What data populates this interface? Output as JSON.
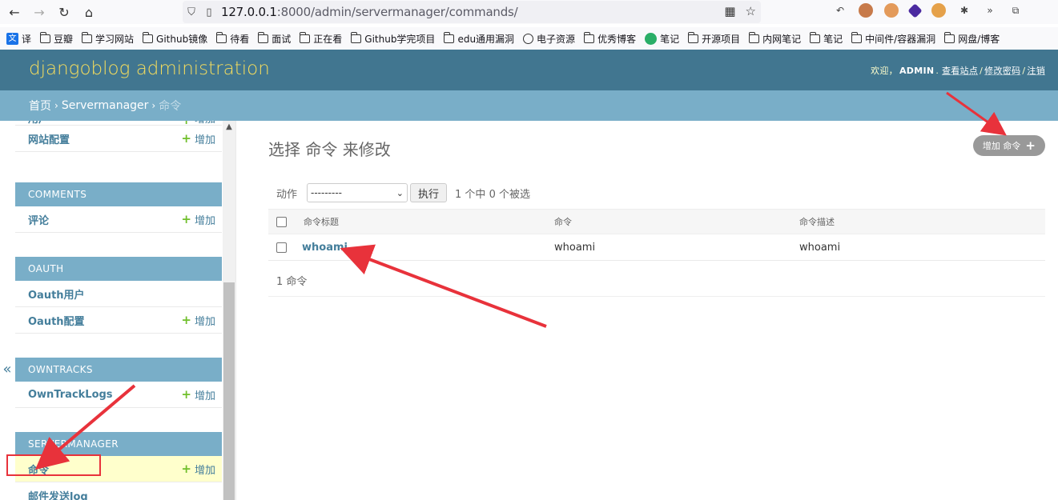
{
  "browser": {
    "url_host": "127.0.0.1",
    "url_rest": ":8000/admin/servermanager/commands/",
    "bookmarks": [
      {
        "label": "译",
        "icon": "translate-icon"
      },
      {
        "label": "豆瓣",
        "icon": "folder-icon"
      },
      {
        "label": "学习网站",
        "icon": "folder-icon"
      },
      {
        "label": "Github镜像",
        "icon": "folder-icon"
      },
      {
        "label": "待看",
        "icon": "folder-icon"
      },
      {
        "label": "面试",
        "icon": "folder-icon"
      },
      {
        "label": "正在看",
        "icon": "folder-icon"
      },
      {
        "label": "Github学完项目",
        "icon": "folder-icon"
      },
      {
        "label": "edu通用漏洞",
        "icon": "folder-icon"
      },
      {
        "label": "电子资源",
        "icon": "globe-icon"
      },
      {
        "label": "优秀博客",
        "icon": "folder-icon"
      },
      {
        "label": "笔记",
        "icon": "wechat-icon"
      },
      {
        "label": "开源项目",
        "icon": "folder-icon"
      },
      {
        "label": "内网笔记",
        "icon": "folder-icon"
      },
      {
        "label": "笔记",
        "icon": "folder-icon"
      },
      {
        "label": "中间件/容器漏洞",
        "icon": "folder-icon"
      },
      {
        "label": "网盘/博客",
        "icon": "folder-icon"
      }
    ]
  },
  "header": {
    "branding": "djangoblog administration",
    "welcome": "欢迎，",
    "username": "ADMIN",
    "view_site": "查看站点",
    "change_password": "修改密码",
    "logout": "注销",
    "separator": "/"
  },
  "breadcrumbs": {
    "home": "首页",
    "app": "Servermanager",
    "current": "命令",
    "arrow": "›"
  },
  "sidebar": {
    "toggle": "«",
    "add_label": "增加",
    "partial_top": "用户",
    "site_config": "网站配置",
    "comments": {
      "caption": "COMMENTS",
      "items": [
        "评论"
      ]
    },
    "oauth": {
      "caption": "OAUTH",
      "items": [
        "Oauth用户",
        "Oauth配置"
      ]
    },
    "owntracks": {
      "caption": "OWNTRACKS",
      "items": [
        "OwnTrackLogs"
      ]
    },
    "servermanager": {
      "caption": "SERVERMANAGER",
      "items": [
        "命令",
        "邮件发送log"
      ]
    }
  },
  "content": {
    "title": "选择 命令 来修改",
    "add_button": "增加 命令",
    "actions_label": "动作",
    "action_select": "---------",
    "go_button": "执行",
    "selection_counter": "1 个中 0 个被选",
    "columns": [
      "命令标题",
      "命令",
      "命令描述"
    ],
    "rows": [
      {
        "title": "whoami",
        "command": "whoami",
        "describe": "whoami"
      }
    ],
    "paginator": "1 命令"
  },
  "colors": {
    "header_bg": "#417690",
    "breadcrumb_bg": "#79aec8",
    "branding": "#f5dd5d",
    "link": "#447e9b",
    "add_green": "#70bf2b",
    "current_row": "#ffffcc",
    "annotation_red": "#e8323b"
  }
}
